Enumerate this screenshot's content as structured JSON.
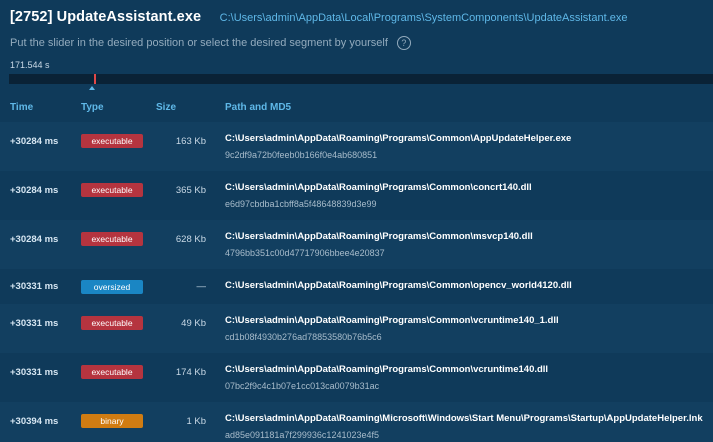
{
  "header": {
    "pid_title": "[2752] UpdateAssistant.exe",
    "exe_path": "C:\\Users\\admin\\AppData\\Local\\Programs\\SystemComponents\\UpdateAssistant.exe",
    "hint": "Put the slider in the desired position or select the desired segment by yourself",
    "help_icon": "?"
  },
  "timeline": {
    "label": "171.544 s"
  },
  "columns": {
    "time": "Time",
    "type": "Type",
    "size": "Size",
    "path": "Path and MD5"
  },
  "colors": {
    "executable": "#b5343f",
    "oversized": "#1a86c4",
    "binary": "#d07c12",
    "accent": "#5fb8e8"
  },
  "rows": [
    {
      "time": "+30284 ms",
      "type": "executable",
      "size": "163 Kb",
      "path": "C:\\Users\\admin\\AppData\\Roaming\\Programs\\Common\\AppUpdateHelper.exe",
      "md5": "9c2df9a72b0feeb0b166f0e4ab680851"
    },
    {
      "time": "+30284 ms",
      "type": "executable",
      "size": "365 Kb",
      "path": "C:\\Users\\admin\\AppData\\Roaming\\Programs\\Common\\concrt140.dll",
      "md5": "e6d97cbdba1cbff8a5f48648839d3e99"
    },
    {
      "time": "+30284 ms",
      "type": "executable",
      "size": "628 Kb",
      "path": "C:\\Users\\admin\\AppData\\Roaming\\Programs\\Common\\msvcp140.dll",
      "md5": "4796bb351c00d47717906bbee4e20837"
    },
    {
      "time": "+30331 ms",
      "type": "oversized",
      "size": "—",
      "path": "C:\\Users\\admin\\AppData\\Roaming\\Programs\\Common\\opencv_world4120.dll",
      "md5": ""
    },
    {
      "time": "+30331 ms",
      "type": "executable",
      "size": "49 Kb",
      "path": "C:\\Users\\admin\\AppData\\Roaming\\Programs\\Common\\vcruntime140_1.dll",
      "md5": "cd1b08f4930b276ad78853580b76b5c6"
    },
    {
      "time": "+30331 ms",
      "type": "executable",
      "size": "174 Kb",
      "path": "C:\\Users\\admin\\AppData\\Roaming\\Programs\\Common\\vcruntime140.dll",
      "md5": "07bc2f9c4c1b07e1cc013ca0079b31ac"
    },
    {
      "time": "+30394 ms",
      "type": "binary",
      "size": "1 Kb",
      "path": "C:\\Users\\admin\\AppData\\Roaming\\Microsoft\\Windows\\Start Menu\\Programs\\Startup\\AppUpdateHelper.lnk",
      "md5": "ad85e091181a7f299936c1241023e4f5"
    }
  ]
}
